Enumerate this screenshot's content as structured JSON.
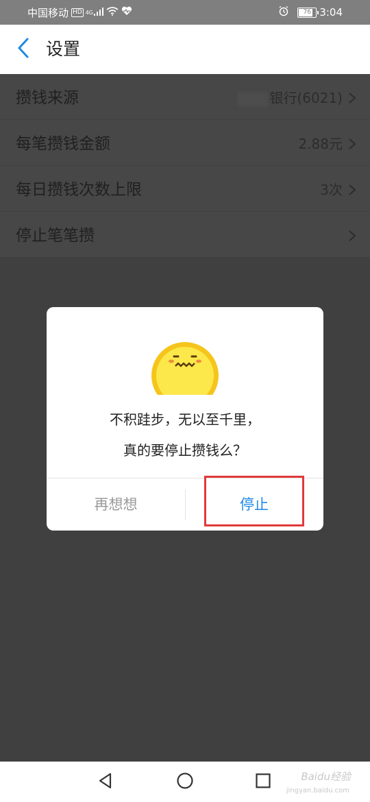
{
  "status_bar": {
    "carrier": "中国移动",
    "hd_badge": "HD",
    "network": "4G",
    "battery_level": "76",
    "time": "3:04"
  },
  "header": {
    "title": "设置"
  },
  "settings": {
    "rows": [
      {
        "label": "攒钱来源",
        "value": "银行(6021)"
      },
      {
        "label": "每笔攒钱金额",
        "value": "2.88元"
      },
      {
        "label": "每日攒钱次数上限",
        "value": "3次"
      },
      {
        "label": "停止笔笔攒",
        "value": ""
      }
    ]
  },
  "dialog": {
    "line1": "不积跬步，无以至千里，",
    "line2": "真的要停止攒钱么？",
    "cancel_label": "再想想",
    "confirm_label": "停止"
  },
  "watermark": {
    "text": "Baidu经验",
    "sub": "jingyan.baidu.com"
  },
  "colors": {
    "accent": "#1e88e5",
    "highlight": "#e03a3a",
    "overlay": "#404040",
    "emoji": "#f5c51c"
  }
}
